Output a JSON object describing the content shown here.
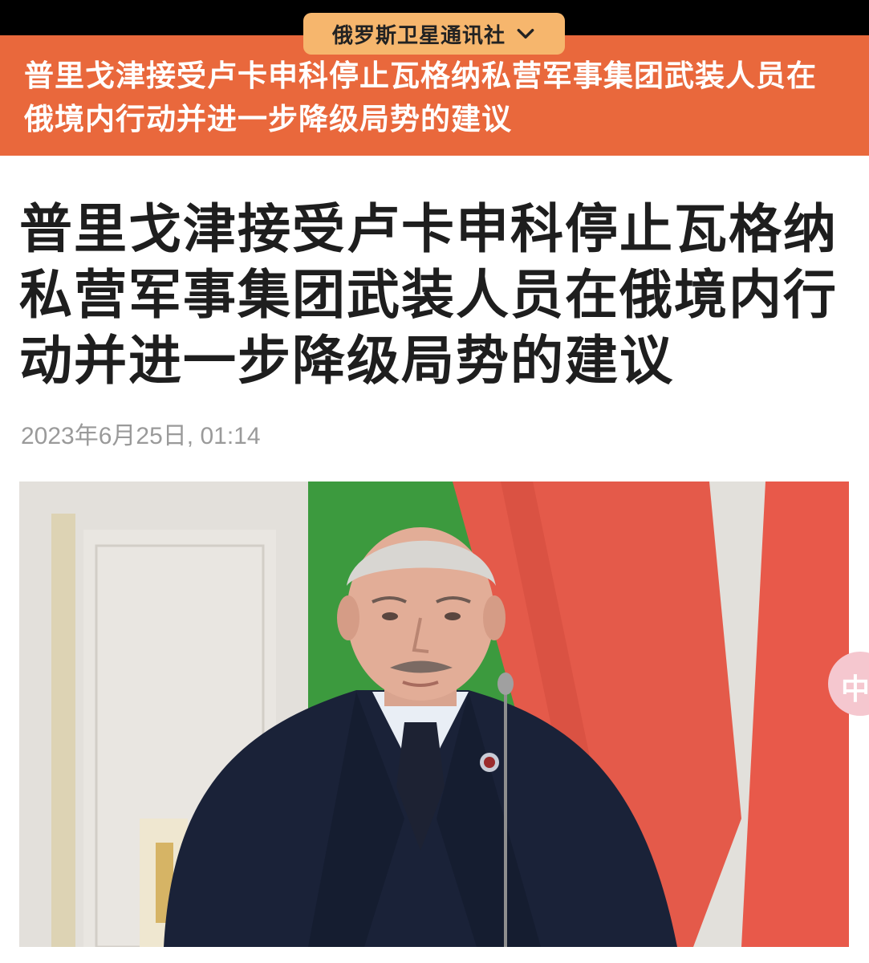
{
  "header": {
    "source_name": "俄罗斯卫星通讯社",
    "chevron_icon": "chevron-down-icon",
    "banner_title": "普里戈津接受卢卡申科停止瓦格纳私营军事集团武装人员在俄境内行动并进一步降级局势的建议"
  },
  "article": {
    "headline": "普里戈津接受卢卡申科停止瓦格纳私营军事集团武装人员在俄境内行动并进一步降级局势的建议",
    "date": "2023年6月25日, 01:14"
  },
  "side_badge": {
    "text": "中"
  },
  "colors": {
    "banner_bg": "#e9683c",
    "pill_bg": "#f6b66d",
    "flag_green": "#3c9a3e",
    "flag_red": "#e45a4a",
    "suit": "#1a2238"
  }
}
